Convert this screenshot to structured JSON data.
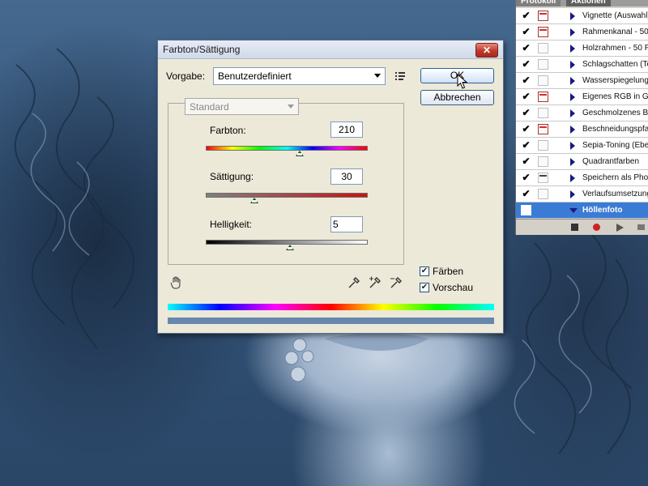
{
  "dialog": {
    "title": "Farbton/Sättigung",
    "close_label": "✕",
    "preset_label": "Vorgabe:",
    "preset_value": "Benutzerdefiniert",
    "ok_label": "OK",
    "cancel_label": "Abbrechen",
    "channel_value": "Standard",
    "hue": {
      "label": "Farbton:",
      "value": "210",
      "level": 0.58
    },
    "saturation": {
      "label": "Sättigung:",
      "value": "30",
      "level": 0.3
    },
    "lightness": {
      "label": "Helligkeit:",
      "value": "5",
      "level": 0.52
    },
    "colorize": {
      "label": "Färben",
      "checked": true
    },
    "preview": {
      "label": "Vorschau",
      "checked": true
    }
  },
  "actions_panel": {
    "tabs": [
      "Protokoll",
      "Aktionen"
    ],
    "items": [
      {
        "label": "Vignette (Auswahl)",
        "dialog": "red"
      },
      {
        "label": "Rahmenkanal - 50 P",
        "dialog": "red"
      },
      {
        "label": "Holzrahmen - 50 Pi",
        "dialog": "none"
      },
      {
        "label": "Schlagschatten (Te",
        "dialog": "none"
      },
      {
        "label": "Wasserspiegelung",
        "dialog": "none"
      },
      {
        "label": "Eigenes RGB in Gra",
        "dialog": "red"
      },
      {
        "label": "Geschmolzenes Ble",
        "dialog": "none"
      },
      {
        "label": "Beschneidungspfad",
        "dialog": "red"
      },
      {
        "label": "Sepia-Toning (Ebe",
        "dialog": "none"
      },
      {
        "label": "Quadrantfarben",
        "dialog": "none"
      },
      {
        "label": "Speichern als Phot",
        "dialog": "dark"
      },
      {
        "label": "Verlaufsumsetzung",
        "dialog": "none"
      }
    ],
    "selected_set": "Höllenfoto"
  }
}
